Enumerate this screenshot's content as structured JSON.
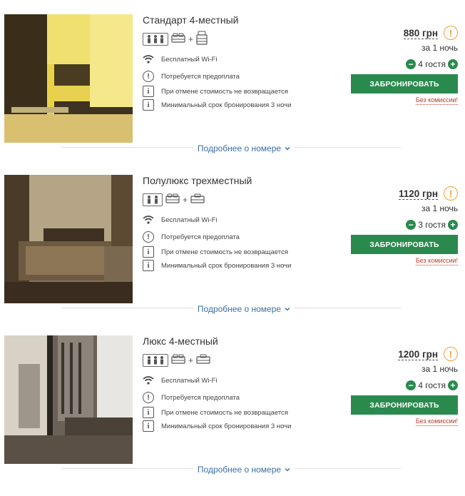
{
  "rooms": [
    {
      "title": "Стандарт 4-местный",
      "guest_icons": [
        "person-icon",
        "person-icon",
        "person-icon"
      ],
      "bed_icons": [
        "double-bed-icon",
        "extra-bed-icon"
      ],
      "amenities": [
        {
          "icon": "wifi-icon",
          "text": "Бесплатный Wi-Fi"
        },
        {
          "icon": "prepayment-icon",
          "text": "Потребуется предоплата"
        },
        {
          "icon": "info-icon",
          "text": "При отмене стоимость не возвращается"
        },
        {
          "icon": "info-icon",
          "text": "Минимальный срок бронирования 3 ночи"
        }
      ],
      "price": "880 грн",
      "per_night": "за 1 ночь",
      "guests": "4 гостя",
      "book_label": "ЗАБРОНИРОВАТЬ",
      "no_commission": "Без комиссии!",
      "more_link": "Подробнее о номере"
    },
    {
      "title": "Полулюкс трехместный",
      "guest_icons": [
        "person-icon",
        "person-icon"
      ],
      "bed_icons": [
        "double-bed-icon",
        "single-bed-icon"
      ],
      "amenities": [
        {
          "icon": "wifi-icon",
          "text": "Бесплатный Wi-Fi"
        },
        {
          "icon": "prepayment-icon",
          "text": "Потребуется предоплата"
        },
        {
          "icon": "info-icon",
          "text": "При отмене стоимость не возвращается"
        },
        {
          "icon": "info-icon",
          "text": "Минимальный срок бронирования 3 ночи"
        }
      ],
      "price": "1120 грн",
      "per_night": "за 1 ночь",
      "guests": "3 гостя",
      "book_label": "ЗАБРОНИРОВАТЬ",
      "no_commission": "Без комиссии!",
      "more_link": "Подробнее о номере"
    },
    {
      "title": "Люкс 4-местный",
      "guest_icons": [
        "person-icon",
        "person-icon",
        "person-icon"
      ],
      "bed_icons": [
        "double-bed-icon",
        "single-bed-icon"
      ],
      "amenities": [
        {
          "icon": "wifi-icon",
          "text": "Бесплатный Wi-Fi"
        },
        {
          "icon": "prepayment-icon",
          "text": "Потребуется предоплата"
        },
        {
          "icon": "info-icon",
          "text": "При отмене стоимость не возвращается"
        },
        {
          "icon": "info-icon",
          "text": "Минимальный срок бронирования 3 ночи"
        }
      ],
      "price": "1200 грн",
      "per_night": "за 1 ночь",
      "guests": "4 гостя",
      "book_label": "ЗАБРОНИРОВАТЬ",
      "no_commission": "Без комиссии!",
      "more_link": "Подробнее о номере"
    }
  ],
  "colors": {
    "accent_green": "#2a8a4e",
    "warning_orange": "#f0a030",
    "link_blue": "#3a6ea5",
    "promo_red": "#c0392b"
  }
}
